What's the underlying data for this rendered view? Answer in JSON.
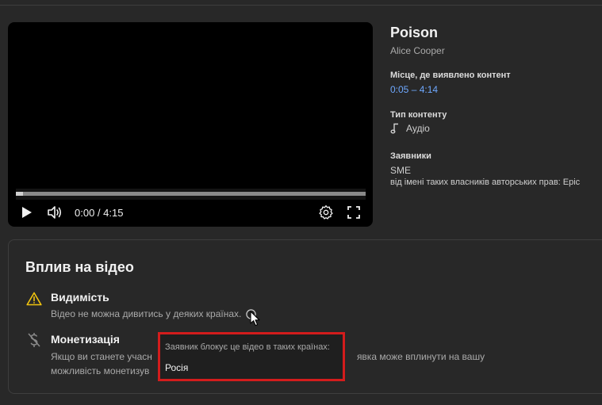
{
  "player": {
    "time": "0:00 / 4:15",
    "progress_fraction": 0
  },
  "song": {
    "title": "Poison",
    "artist": "Alice Cooper"
  },
  "details": {
    "found_label": "Місце, де виявлено контент",
    "found_range": "0:05 – 4:14",
    "type_label": "Тип контенту",
    "type_value": "Аудіо",
    "claimants_label": "Заявники",
    "claimant_name": "SME",
    "claimant_note": "від імені таких власників авторських прав: Epic"
  },
  "impact": {
    "title": "Вплив на відео",
    "visibility_title": "Видимість",
    "visibility_text": "Відео не можна дивитись у деяких країнах.",
    "monetization_title": "Монетизація",
    "monetization_text_left_1": "Якщо ви станете учасн",
    "monetization_text_right_1": "явка може вплинути на вашу",
    "monetization_text_2": "можливість монетизув"
  },
  "tooltip": {
    "heading": "Заявник блокує це відео в таких країнах:",
    "country": "Росія"
  },
  "colors": {
    "accent_link": "#6ea8fe",
    "warning": "#f1c40f",
    "highlight_border": "#d31c1c"
  }
}
